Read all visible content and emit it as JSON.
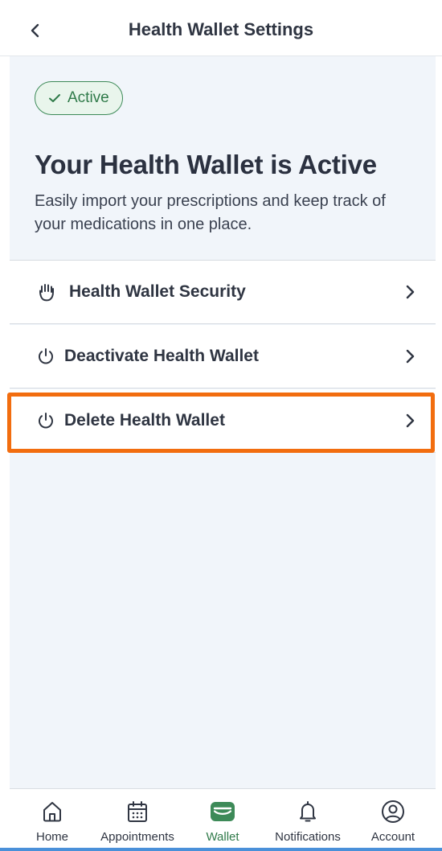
{
  "header": {
    "title": "Health Wallet Settings",
    "back_icon": "chevron-left-icon"
  },
  "hero": {
    "badge_label": "Active",
    "badge_icon": "check-icon",
    "title": "Your Health Wallet is Active",
    "description": "Easily import your prescriptions and keep track of your medications in one place."
  },
  "menu": {
    "items": [
      {
        "label": "Health Wallet Security",
        "icon": "hand-icon"
      },
      {
        "label": "Deactivate Health Wallet",
        "icon": "power-icon"
      },
      {
        "label": "Delete Health Wallet",
        "icon": "power-icon"
      }
    ]
  },
  "tabbar": {
    "tabs": [
      {
        "label": "Home",
        "icon": "home-icon"
      },
      {
        "label": "Appointments",
        "icon": "calendar-icon"
      },
      {
        "label": "Wallet",
        "icon": "wallet-icon",
        "active": true
      },
      {
        "label": "Notifications",
        "icon": "bell-icon"
      },
      {
        "label": "Account",
        "icon": "account-icon"
      }
    ]
  },
  "colors": {
    "accent_green": "#2f7a49",
    "highlight_orange": "#f26d0f",
    "background": "#f1f5fa",
    "text": "#2f3542"
  }
}
